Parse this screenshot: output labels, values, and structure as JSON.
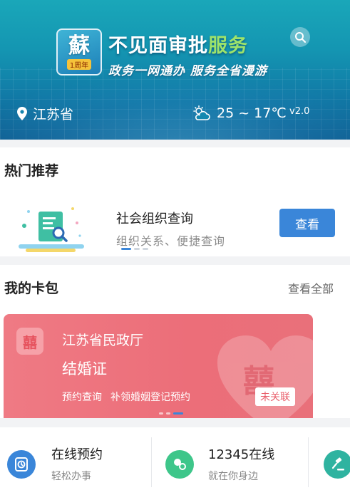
{
  "banner": {
    "logo_char": "蘇",
    "logo_sub": "1周年",
    "title_main": "不见面审批",
    "title_accent": "服务",
    "slogan": "政务一网通办 服务全省漫游",
    "location": "江苏省",
    "weather": "25 ~ 17℃",
    "version": "v2.0"
  },
  "hot": {
    "section_title": "热门推荐",
    "item_title": "社会组织查询",
    "item_sub": "组织关系、便捷查询",
    "action_label": "查看"
  },
  "wallet": {
    "section_title": "我的卡包",
    "see_all": "查看全部",
    "card": {
      "icon_char": "囍",
      "org": "江苏省民政厅",
      "name": "结婚证",
      "links": [
        "预约查询",
        "补领婚姻登记预约"
      ],
      "badge": "未关联",
      "watermark": "囍"
    }
  },
  "services": [
    {
      "title": "在线预约",
      "sub": "轻松办事",
      "icon": "clock-icon"
    },
    {
      "title": "12345在线",
      "sub": "就在你身边",
      "icon": "bubbles-icon"
    }
  ],
  "colors": {
    "primary": "#3a86d9",
    "card": "#ec6e79",
    "accent_green": "#9ee36a"
  }
}
